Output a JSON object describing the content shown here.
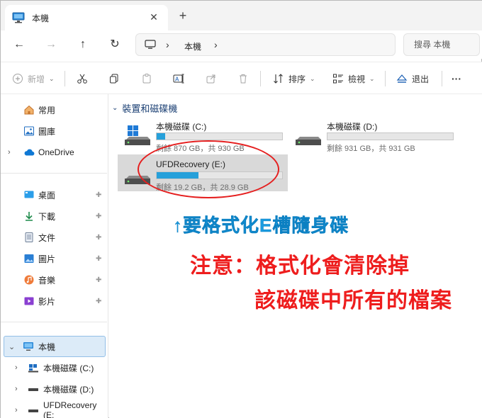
{
  "window": {
    "tab_title": "本機",
    "tab_close": "✕",
    "new_tab": "+"
  },
  "address": {
    "sep": "›",
    "crumb": "本機",
    "search_placeholder": "搜尋 本機"
  },
  "nav": {
    "back": "←",
    "forward": "→",
    "up": "↑",
    "refresh": "↻"
  },
  "toolbar": {
    "new_label": "新增",
    "sort_label": "排序",
    "view_label": "檢視",
    "eject_label": "退出",
    "more_label": "···"
  },
  "sidebar": {
    "top_items": [
      {
        "label": "常用",
        "icon": "home-icon"
      },
      {
        "label": "圖庫",
        "icon": "gallery-icon"
      },
      {
        "label": "OneDrive",
        "icon": "cloud-icon"
      }
    ],
    "pinned": [
      {
        "label": "桌面",
        "icon": "desktop-icon"
      },
      {
        "label": "下載",
        "icon": "download-icon"
      },
      {
        "label": "文件",
        "icon": "document-icon"
      },
      {
        "label": "圖片",
        "icon": "pictures-icon"
      },
      {
        "label": "音樂",
        "icon": "music-icon"
      },
      {
        "label": "影片",
        "icon": "video-icon"
      }
    ],
    "pin_glyph": "📌",
    "this_pc": "本機",
    "drives": [
      {
        "label": "本機磁碟 (C:)"
      },
      {
        "label": "本機磁碟 (D:)"
      },
      {
        "label": "UFDRecovery (E:"
      }
    ]
  },
  "content": {
    "group_title": "裝置和磁碟機",
    "drives": [
      {
        "name": "本機磁碟 (C:)",
        "free_text": "剩餘 870 GB，共 930 GB",
        "used_fraction": 0.065
      },
      {
        "name": "本機磁碟 (D:)",
        "free_text": "剩餘 931 GB，共 931 GB",
        "used_fraction": 0.0
      },
      {
        "name": "UFDRecovery (E:)",
        "free_text": "剩餘 19.2 GB，共 28.9 GB",
        "used_fraction": 0.336
      }
    ]
  },
  "annotations": {
    "blue_note": "↑要格式化E槽隨身碟",
    "red_line1": "注意：格式化會清除掉",
    "red_line2": "該磁碟中所有的檔案"
  },
  "colors": {
    "accent": "#26a0da",
    "annotation_red": "#ee1d1d",
    "annotation_blue": "#1a9be0",
    "selection": "#dcebf8"
  }
}
